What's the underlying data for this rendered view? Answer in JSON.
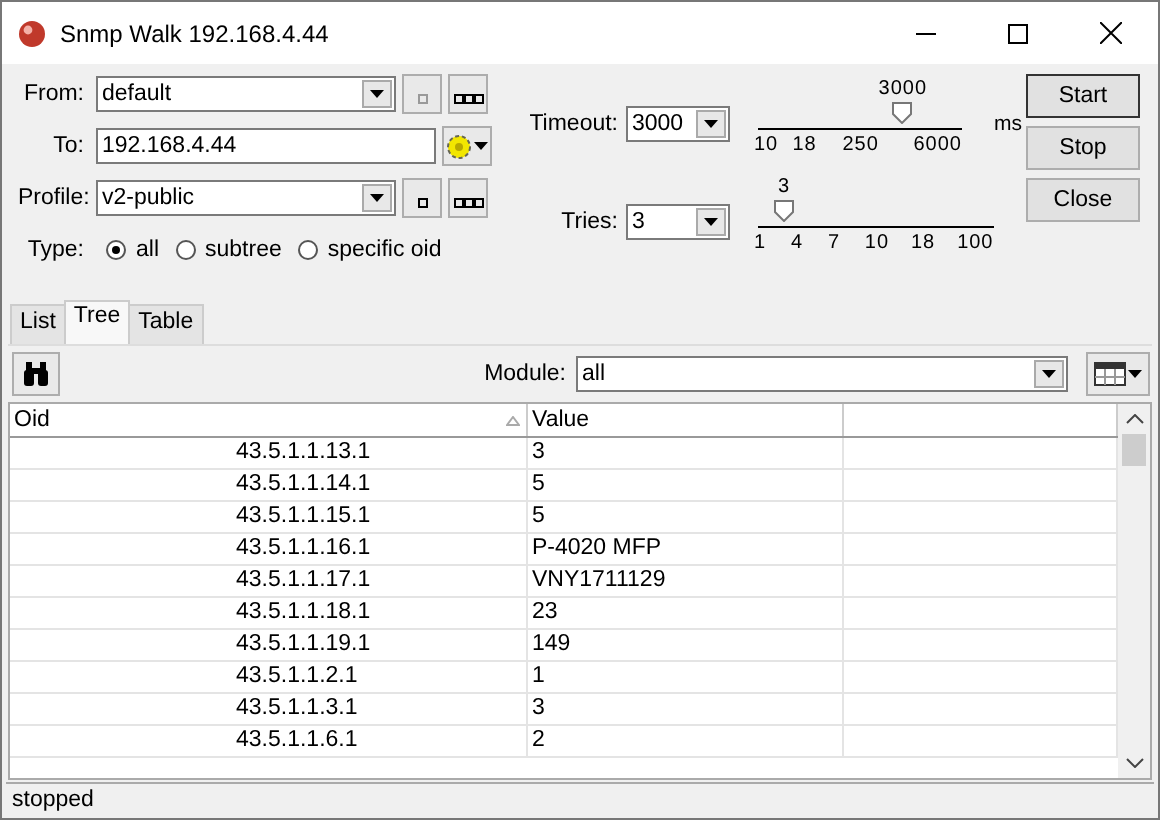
{
  "window": {
    "title": "Snmp Walk 192.168.4.44"
  },
  "form": {
    "from_label": "From:",
    "from_value": "default",
    "to_label": "To:",
    "to_value": "192.168.4.44",
    "profile_label": "Profile:",
    "profile_value": "v2-public",
    "type_label": "Type:",
    "types": [
      {
        "label": "all",
        "selected": true
      },
      {
        "label": "subtree",
        "selected": false
      },
      {
        "label": "specific oid",
        "selected": false
      }
    ],
    "timeout_label": "Timeout:",
    "timeout_value": "3000",
    "timeout_slider": {
      "reading": "3000",
      "level": 0.71,
      "ticks": [
        "10",
        "18",
        "250",
        "6000"
      ]
    },
    "timeout_unit": "ms",
    "tries_label": "Tries:",
    "tries_value": "3",
    "tries_slider": {
      "reading": "3",
      "level": 0.11,
      "ticks": [
        "1",
        "4",
        "7",
        "10",
        "18",
        "100"
      ]
    }
  },
  "buttons": [
    "Start",
    "Stop",
    "Close"
  ],
  "tabs": [
    {
      "label": "List",
      "selected": false
    },
    {
      "label": "Tree",
      "selected": true
    },
    {
      "label": "Table",
      "selected": false
    }
  ],
  "module": {
    "label": "Module:",
    "value": "all"
  },
  "table": {
    "columns": [
      "Oid",
      "Value"
    ],
    "rows": [
      {
        "oid": "43.5.1.1.13.1",
        "value": "3"
      },
      {
        "oid": "43.5.1.1.14.1",
        "value": "5"
      },
      {
        "oid": "43.5.1.1.15.1",
        "value": "5"
      },
      {
        "oid": "43.5.1.1.16.1",
        "value": "P-4020 MFP"
      },
      {
        "oid": "43.5.1.1.17.1",
        "value": "VNY1711129"
      },
      {
        "oid": "43.5.1.1.18.1",
        "value": "23"
      },
      {
        "oid": "43.5.1.1.19.1",
        "value": "149"
      },
      {
        "oid": "43.5.1.1.2.1",
        "value": "1"
      },
      {
        "oid": "43.5.1.1.3.1",
        "value": "3"
      },
      {
        "oid": "43.5.1.1.6.1",
        "value": "2"
      }
    ]
  },
  "status_bar": "stopped"
}
